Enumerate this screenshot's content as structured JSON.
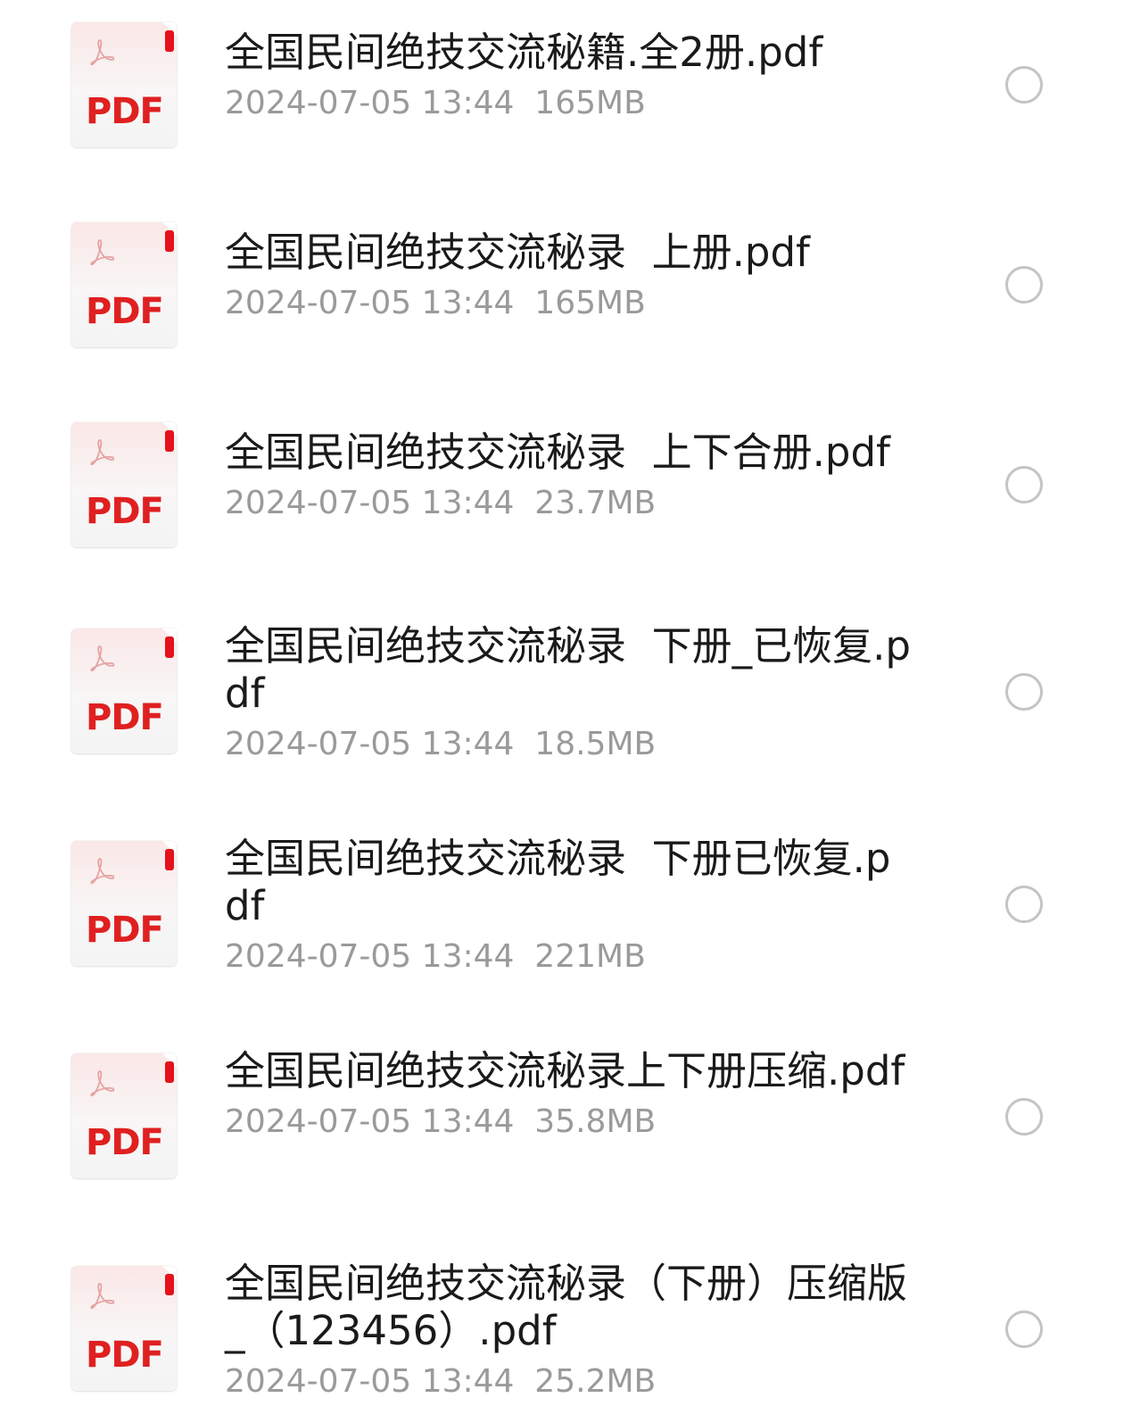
{
  "file_type_label": "PDF",
  "colors": {
    "pdf_red": "#df2020",
    "name_text": "#1a1a1a",
    "meta_text": "#9a9a9a",
    "radio_border": "#c4c4c4"
  },
  "files": [
    {
      "name": "全国民间绝技交流秘籍.全2册.pdf",
      "date": "2024-07-05 13:44",
      "size": "165MB"
    },
    {
      "name": "全国民间绝技交流秘录  上册.pdf",
      "date": "2024-07-05 13:44",
      "size": "165MB"
    },
    {
      "name": "全国民间绝技交流秘录  上下合册.pdf",
      "date": "2024-07-05 13:44",
      "size": "23.7MB"
    },
    {
      "name": "全国民间绝技交流秘录  下册_已恢复.pdf",
      "date": "2024-07-05 13:44",
      "size": "18.5MB"
    },
    {
      "name": "全国民间绝技交流秘录  下册已恢复.pdf",
      "date": "2024-07-05 13:44",
      "size": "221MB"
    },
    {
      "name": "全国民间绝技交流秘录上下册压缩.pdf",
      "date": "2024-07-05 13:44",
      "size": "35.8MB"
    },
    {
      "name": "全国民间绝技交流秘录（下册）压缩版_（123456）.pdf",
      "date": "2024-07-05 13:44",
      "size": "25.2MB"
    }
  ]
}
